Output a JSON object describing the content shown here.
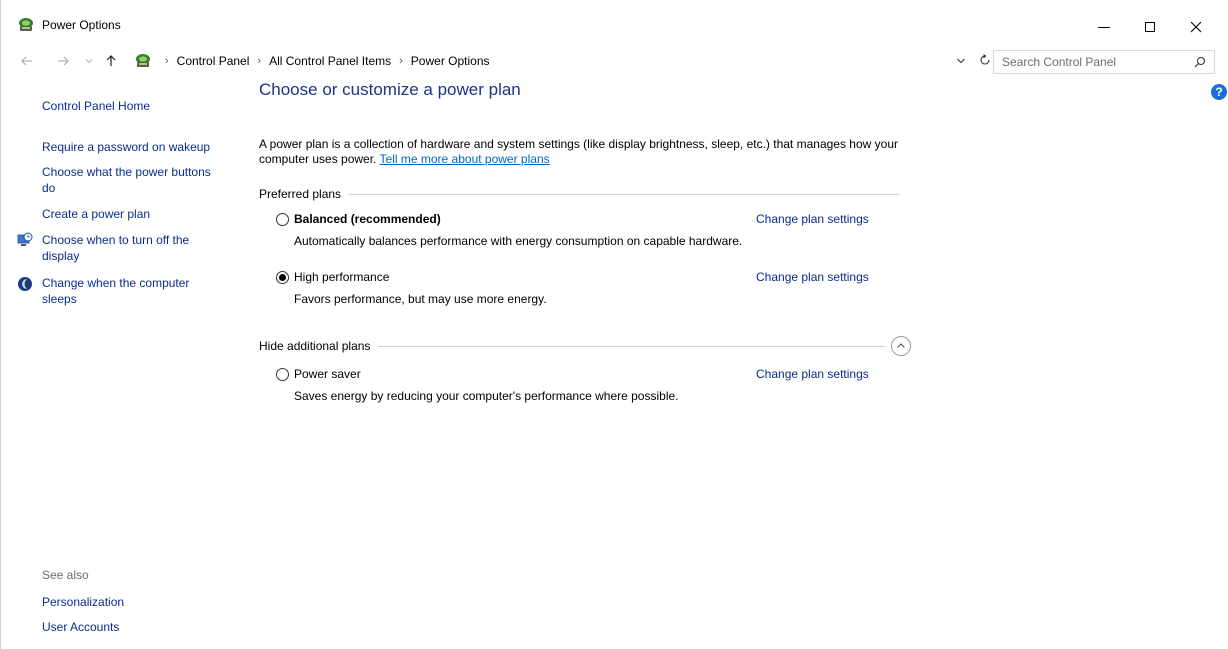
{
  "window": {
    "title": "Power Options"
  },
  "navigation": {
    "breadcrumbs": [
      "Control Panel",
      "All Control Panel Items",
      "Power Options"
    ],
    "search_placeholder": "Search Control Panel"
  },
  "icons": {
    "app": "power-options-icon",
    "back": "back-arrow-icon",
    "forward": "forward-arrow-icon",
    "recent": "chevron-down-icon",
    "up": "up-arrow-icon",
    "refresh": "refresh-icon",
    "search": "search-icon",
    "help": "help-icon",
    "display": "monitor-clock-icon",
    "sleep": "moon-icon",
    "collapse": "chevron-up-icon"
  },
  "left_pane": {
    "home": "Control Panel Home",
    "password": "Require a password on wakeup",
    "buttons": "Choose what the power buttons do",
    "create_plan": "Create a power plan",
    "display_off": "Choose when to turn off the display",
    "sleep": "Change when the computer sleeps",
    "see_also": "See also",
    "personalization": "Personalization",
    "user_accounts": "User Accounts"
  },
  "main": {
    "title": "Choose or customize a power plan",
    "description": "A power plan is a collection of hardware and system settings (like display brightness, sleep, etc.) that manages how your computer uses power.",
    "learn_more": "Tell me more about power plans",
    "preferred_label": "Preferred plans",
    "additional_label": "Hide additional plans",
    "plans": [
      {
        "name": "Balanced (recommended)",
        "description": "Automatically balances performance with energy consumption on capable hardware.",
        "settings_link": "Change plan settings",
        "selected": false
      },
      {
        "name": "High performance",
        "description": "Favors performance, but may use more energy.",
        "settings_link": "Change plan settings",
        "selected": true
      },
      {
        "name": "Power saver",
        "description": "Saves energy by reducing your computer's performance where possible.",
        "settings_link": "Change plan settings",
        "selected": false
      }
    ]
  },
  "colors": {
    "title_blue": "#1e3287",
    "link_blue": "#0a2c8c",
    "accent_blue": "#0066cc",
    "help_blue": "#1a6ed8"
  }
}
